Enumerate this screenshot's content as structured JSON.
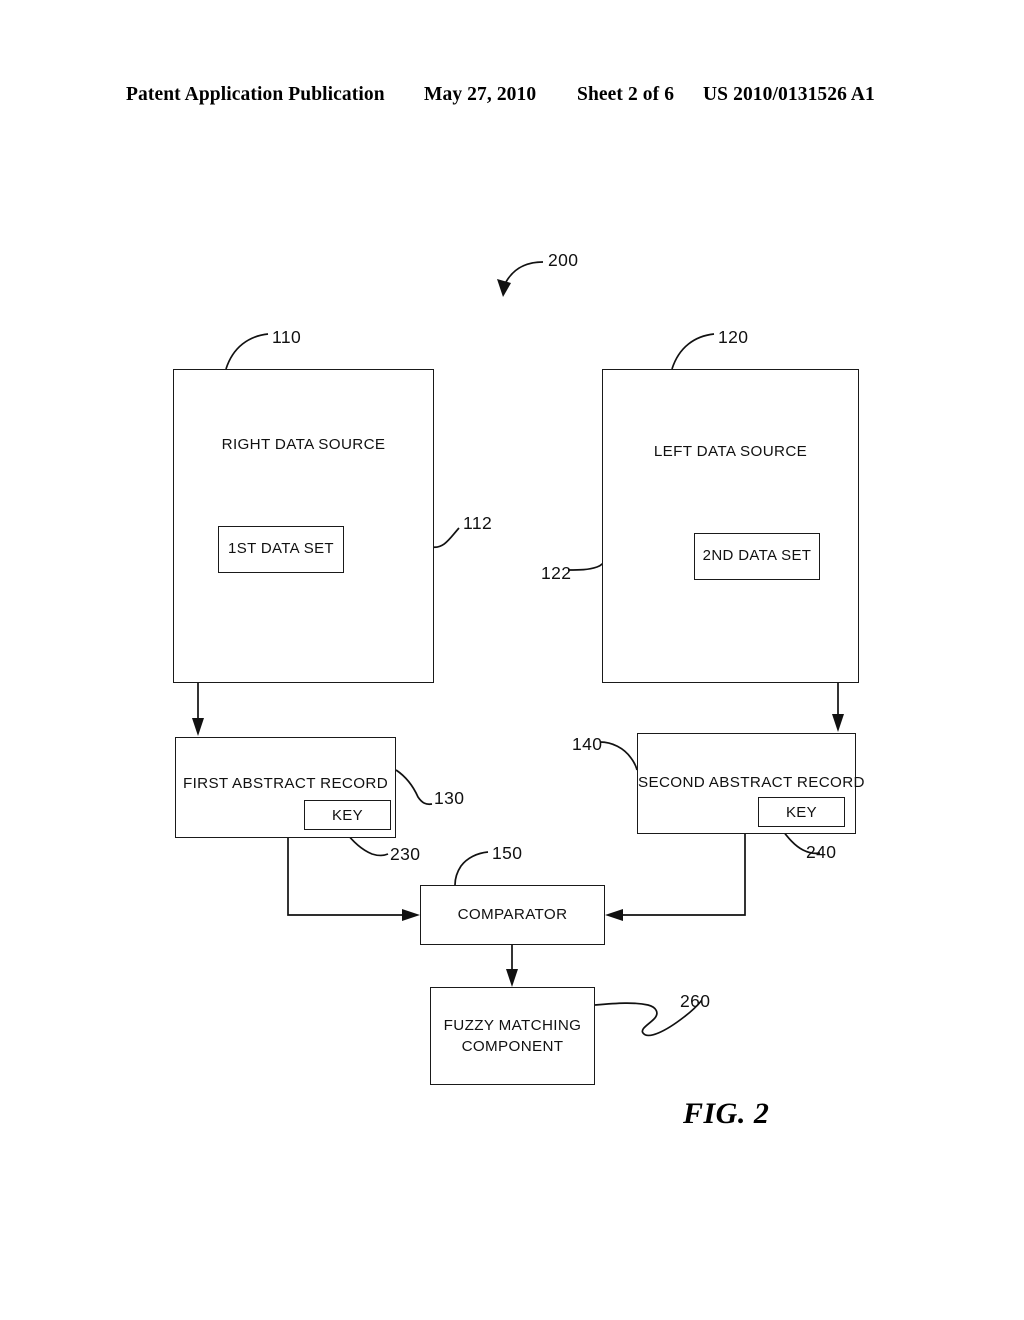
{
  "header": {
    "publication": "Patent Application Publication",
    "date": "May 27, 2010",
    "sheet": "Sheet 2 of 6",
    "patent_number": "US 2010/0131526 A1"
  },
  "figure": {
    "caption": "FIG. 2",
    "diagram_ref": "200"
  },
  "blocks": {
    "right_data_source": {
      "label": "RIGHT DATA SOURCE",
      "ref": "110"
    },
    "left_data_source": {
      "label": "LEFT DATA SOURCE",
      "ref": "120"
    },
    "first_data_set": {
      "label": "1ST DATA SET",
      "ref": "112"
    },
    "second_data_set": {
      "label": "2ND DATA SET",
      "ref": "122"
    },
    "first_abstract_record": {
      "label": "FIRST ABSTRACT RECORD",
      "ref": "130"
    },
    "second_abstract_record": {
      "label": "SECOND ABSTRACT RECORD",
      "ref": "140"
    },
    "first_key": {
      "label": "KEY",
      "ref": "230"
    },
    "second_key": {
      "label": "KEY",
      "ref": "240"
    },
    "comparator": {
      "label": "COMPARATOR",
      "ref": "150"
    },
    "fuzzy_matching_component": {
      "label": "FUZZY MATCHING\nCOMPONENT",
      "line1": "FUZZY MATCHING",
      "line2": "COMPONENT",
      "ref": "260"
    }
  },
  "colors": {
    "ink": "#111111",
    "paper": "#ffffff"
  }
}
